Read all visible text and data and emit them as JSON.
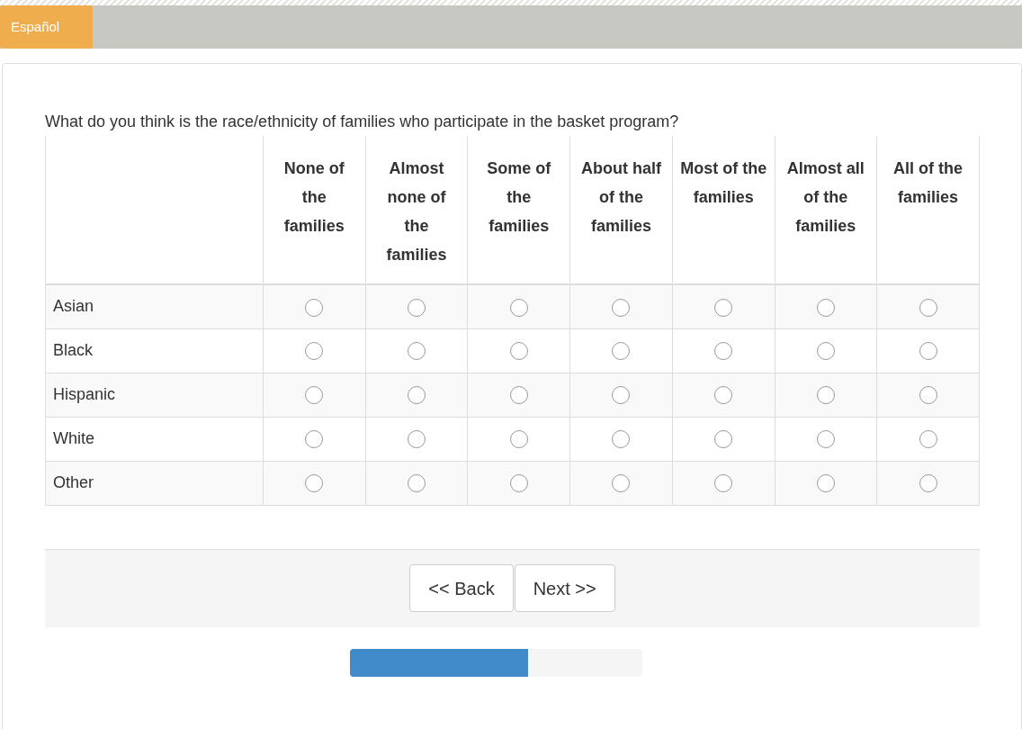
{
  "language_button": "Español",
  "question": "What do you think is the race/ethnicity of families who participate in the basket program?",
  "columns": [
    "None of the families",
    "Almost none of the families",
    "Some of the families",
    "About half of the families",
    "Most of the families",
    "Almost all of the families",
    "All of the families"
  ],
  "rows": [
    {
      "label": "Asian",
      "choices": [
        {
          "selected": false
        },
        {
          "selected": false
        },
        {
          "selected": false
        },
        {
          "selected": false
        },
        {
          "selected": false
        },
        {
          "selected": false
        },
        {
          "selected": false
        }
      ]
    },
    {
      "label": "Black",
      "choices": [
        {
          "selected": false
        },
        {
          "selected": false
        },
        {
          "selected": false
        },
        {
          "selected": false
        },
        {
          "selected": false
        },
        {
          "selected": false
        },
        {
          "selected": false
        }
      ]
    },
    {
      "label": "Hispanic",
      "choices": [
        {
          "selected": false
        },
        {
          "selected": false
        },
        {
          "selected": false
        },
        {
          "selected": false
        },
        {
          "selected": false
        },
        {
          "selected": false
        },
        {
          "selected": false
        }
      ]
    },
    {
      "label": "White",
      "choices": [
        {
          "selected": false
        },
        {
          "selected": false
        },
        {
          "selected": false
        },
        {
          "selected": false
        },
        {
          "selected": false
        },
        {
          "selected": false
        },
        {
          "selected": false
        }
      ]
    },
    {
      "label": "Other",
      "choices": [
        {
          "selected": false
        },
        {
          "selected": false
        },
        {
          "selected": false
        },
        {
          "selected": false
        },
        {
          "selected": false
        },
        {
          "selected": false
        },
        {
          "selected": false
        }
      ]
    }
  ],
  "buttons": [
    "<< Back",
    "Next >>"
  ],
  "progress": {
    "level": 0.61
  }
}
